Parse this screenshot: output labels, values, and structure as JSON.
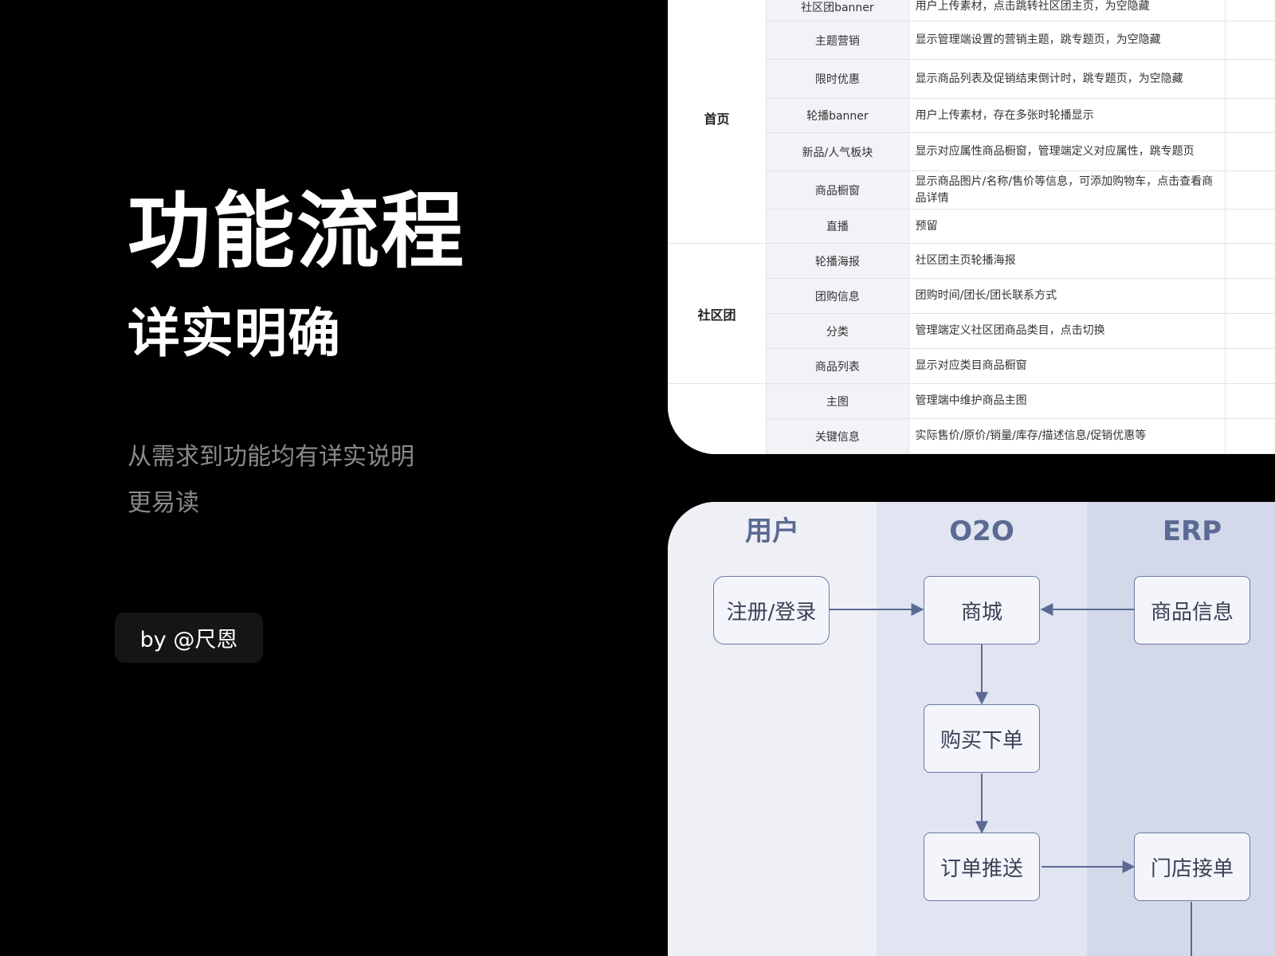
{
  "hero": {
    "title": "功能流程",
    "subtitle": "详实明确",
    "desc_line1": "从需求到功能均有详实说明",
    "desc_line2": "更易读",
    "author": "by @尺恩"
  },
  "table": {
    "groups": [
      {
        "label": "首页",
        "rows": [
          {
            "name": "社区团banner",
            "desc": "用户上传素材，点击跳转社区团主页，为空隐藏"
          },
          {
            "name": "主题营销",
            "desc": "显示管理端设置的营销主题，跳专题页，为空隐藏"
          },
          {
            "name": "限时优惠",
            "desc": "显示商品列表及促销结束倒计时，跳专题页，为空隐藏"
          },
          {
            "name": "轮播banner",
            "desc": "用户上传素材，存在多张时轮播显示"
          },
          {
            "name": "新品/人气板块",
            "desc": "显示对应属性商品橱窗，管理端定义对应属性，跳专题页"
          },
          {
            "name": "商品橱窗",
            "desc": "显示商品图片/名称/售价等信息，可添加购物车，点击查看商品详情"
          },
          {
            "name": "直播",
            "desc": "预留"
          }
        ]
      },
      {
        "label": "社区团",
        "rows": [
          {
            "name": "轮播海报",
            "desc": "社区团主页轮播海报"
          },
          {
            "name": "团购信息",
            "desc": "团购时间/团长/团长联系方式"
          },
          {
            "name": "分类",
            "desc": "管理端定义社区团商品类目，点击切换"
          },
          {
            "name": "商品列表",
            "desc": "显示对应类目商品橱窗"
          }
        ]
      },
      {
        "label": "",
        "rows": [
          {
            "name": "主图",
            "desc": "管理端中维护商品主图"
          },
          {
            "name": "关键信息",
            "desc": "实际售价/原价/销量/库存/描述信息/促销优惠等"
          }
        ]
      }
    ]
  },
  "flow": {
    "lanes": {
      "user": "用户",
      "o2o": "O2O",
      "erp": "ERP"
    },
    "nodes": {
      "register": "注册/登录",
      "mall": "商城",
      "product_info": "商品信息",
      "order": "购买下单",
      "push": "订单推送",
      "store_accept": "门店接单"
    }
  },
  "colors": {
    "flow_line": "#5b6a92",
    "lane_user": "#eef0f6",
    "lane_o2o": "#e1e5f1",
    "lane_erp": "#d3d9ea"
  }
}
